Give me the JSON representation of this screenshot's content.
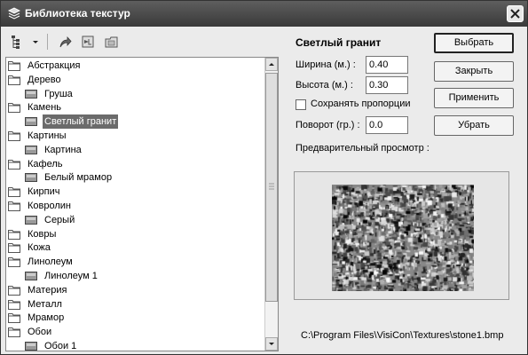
{
  "window": {
    "title": "Библиотека текстур"
  },
  "tree": {
    "items": [
      {
        "label": "Абстракция",
        "type": "folder",
        "level": 0
      },
      {
        "label": "Дерево",
        "type": "folder",
        "level": 0
      },
      {
        "label": "Груша",
        "type": "texture",
        "level": 1
      },
      {
        "label": "Камень",
        "type": "folder",
        "level": 0
      },
      {
        "label": "Светлый гранит",
        "type": "texture",
        "level": 1,
        "selected": true
      },
      {
        "label": "Картины",
        "type": "folder",
        "level": 0
      },
      {
        "label": "Картина",
        "type": "texture",
        "level": 1
      },
      {
        "label": "Кафель",
        "type": "folder",
        "level": 0
      },
      {
        "label": "Белый мрамор",
        "type": "texture",
        "level": 1
      },
      {
        "label": "Кирпич",
        "type": "folder",
        "level": 0
      },
      {
        "label": "Ковролин",
        "type": "folder",
        "level": 0
      },
      {
        "label": "Серый",
        "type": "texture",
        "level": 1
      },
      {
        "label": "Ковры",
        "type": "folder",
        "level": 0
      },
      {
        "label": "Кожа",
        "type": "folder",
        "level": 0
      },
      {
        "label": "Линолеум",
        "type": "folder",
        "level": 0
      },
      {
        "label": "Линолеум 1",
        "type": "texture",
        "level": 1
      },
      {
        "label": "Материя",
        "type": "folder",
        "level": 0
      },
      {
        "label": "Металл",
        "type": "folder",
        "level": 0
      },
      {
        "label": "Мрамор",
        "type": "folder",
        "level": 0
      },
      {
        "label": "Обои",
        "type": "folder",
        "level": 0
      },
      {
        "label": "Обои 1",
        "type": "texture",
        "level": 1
      }
    ]
  },
  "details": {
    "name": "Светлый гранит",
    "width_label": "Ширина (м.) :",
    "width_value": "0.40",
    "height_label": "Высота (м.) :",
    "height_value": "0.30",
    "keep_proportions_label": "Сохранять пропорции",
    "keep_proportions_checked": false,
    "rotation_label": "Поворот (гр.) :",
    "rotation_value": "0.0",
    "preview_label": "Предварительный просмотр :",
    "file_path": "C:\\Program Files\\VisiCon\\Textures\\stone1.bmp"
  },
  "buttons": {
    "select": "Выбрать",
    "close": "Закрыть",
    "apply": "Применить",
    "remove": "Убрать"
  },
  "icons": {
    "title": "texture-library-icon",
    "view_mode": "tree-view-icon",
    "view_dropdown": "dropdown-arrow-icon",
    "up": "up-folder-icon",
    "import": "import-icon",
    "new_folder": "new-folder-icon",
    "close": "close-icon"
  }
}
